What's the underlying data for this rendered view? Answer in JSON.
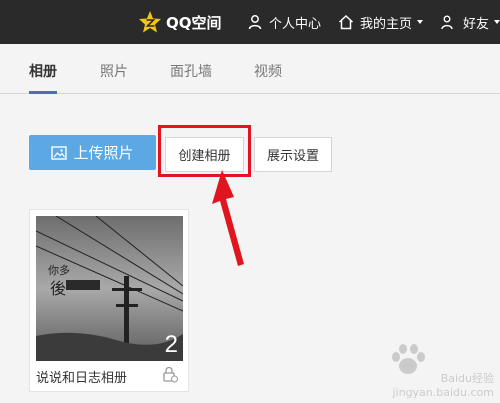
{
  "topbar": {
    "brand": "QQ空间",
    "personal_center": "个人中心",
    "my_home": "我的主页",
    "friends": "好友",
    "icons": [
      "qzone-star-icon",
      "user-icon",
      "home-icon"
    ],
    "background_color": "#2a2a2a"
  },
  "tabs": [
    {
      "label": "相册",
      "active": true
    },
    {
      "label": "照片",
      "active": false
    },
    {
      "label": "面孔墙",
      "active": false
    },
    {
      "label": "视频",
      "active": false
    }
  ],
  "toolbar": {
    "upload_label": "上传照片",
    "create_album_label": "创建相册",
    "display_settings_label": "展示设置",
    "upload_color": "#5ba8e5",
    "highlight_color": "#e0151f"
  },
  "albums": [
    {
      "title": "说说和日志相册",
      "photo_count": "2",
      "icon": "lock-icon"
    }
  ],
  "watermark": {
    "text": "Baidu经验",
    "url": "jingyan.baidu.com"
  }
}
